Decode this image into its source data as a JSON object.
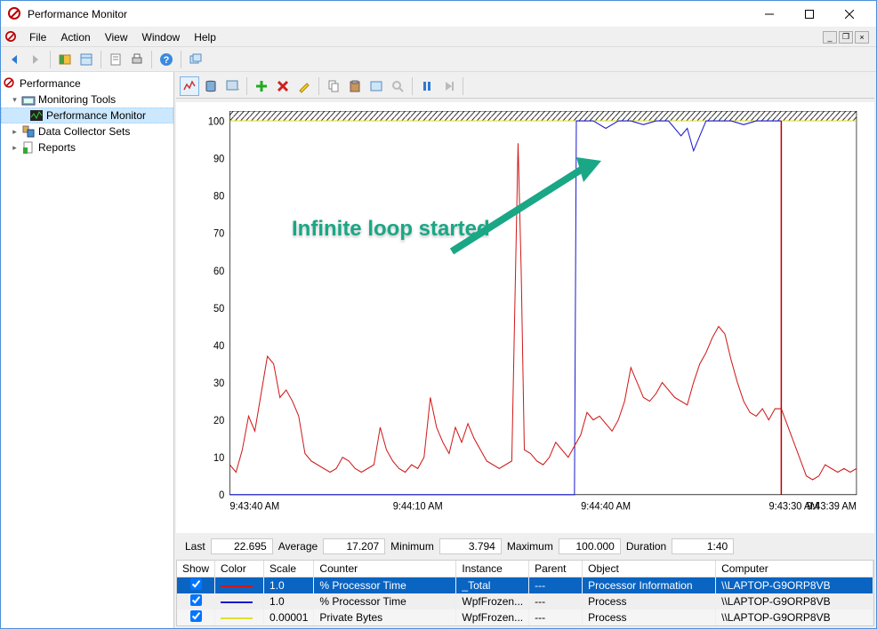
{
  "window": {
    "title": "Performance Monitor"
  },
  "menu": {
    "file": "File",
    "action": "Action",
    "view": "View",
    "window": "Window",
    "help": "Help"
  },
  "tree": {
    "root": "Performance",
    "monitoring": "Monitoring Tools",
    "perfmon": "Performance Monitor",
    "dcs": "Data Collector Sets",
    "reports": "Reports"
  },
  "annotation": "Infinite loop started",
  "stats": {
    "last_label": "Last",
    "last": "22.695",
    "avg_label": "Average",
    "avg": "17.207",
    "min_label": "Minimum",
    "min": "3.794",
    "max_label": "Maximum",
    "max": "100.000",
    "dur_label": "Duration",
    "dur": "1:40"
  },
  "xticks": {
    "t0": "9:43:40 AM",
    "t1": "9:44:10 AM",
    "t2": "9:44:40 AM",
    "t3": "9:43:30 AM",
    "t4": "9:43:39 AM"
  },
  "columns": {
    "show": "Show",
    "color": "Color",
    "scale": "Scale",
    "counter": "Counter",
    "instance": "Instance",
    "parent": "Parent",
    "object": "Object",
    "computer": "Computer"
  },
  "rows": [
    {
      "scale": "1.0",
      "counter": "% Processor Time",
      "instance": "_Total",
      "parent": "---",
      "object": "Processor Information",
      "computer": "\\\\LAPTOP-G9ORP8VB",
      "color": "#d01818"
    },
    {
      "scale": "1.0",
      "counter": "% Processor Time",
      "instance": "WpfFrozen...",
      "parent": "---",
      "object": "Process",
      "computer": "\\\\LAPTOP-G9ORP8VB",
      "color": "#1818d0"
    },
    {
      "scale": "0.00001",
      "counter": "Private Bytes",
      "instance": "WpfFrozen...",
      "parent": "---",
      "object": "Process",
      "computer": "\\\\LAPTOP-G9ORP8VB",
      "color": "#e0e030"
    }
  ],
  "chart_data": {
    "type": "line",
    "ylim": [
      0,
      100
    ],
    "yticks": [
      0,
      10,
      20,
      30,
      40,
      50,
      60,
      70,
      80,
      90,
      100
    ],
    "x_range_seconds": [
      0,
      100
    ],
    "x_tick_labels": [
      "9:43:40 AM",
      "9:44:10 AM",
      "9:44:40 AM",
      "9:43:30 AM",
      "9:43:39 AM"
    ],
    "time_bar_x": 88,
    "series": [
      {
        "name": "% Processor Time — Processor Information — _Total",
        "color": "#d01818",
        "points": [
          [
            0,
            8
          ],
          [
            1,
            6
          ],
          [
            2,
            12
          ],
          [
            3,
            21
          ],
          [
            4,
            17
          ],
          [
            6,
            37
          ],
          [
            7,
            35
          ],
          [
            8,
            26
          ],
          [
            9,
            28
          ],
          [
            10,
            25
          ],
          [
            11,
            21
          ],
          [
            12,
            11
          ],
          [
            13,
            9
          ],
          [
            14,
            8
          ],
          [
            15,
            7
          ],
          [
            16,
            6
          ],
          [
            17,
            7
          ],
          [
            18,
            10
          ],
          [
            19,
            9
          ],
          [
            20,
            7
          ],
          [
            21,
            6
          ],
          [
            22,
            7
          ],
          [
            23,
            8
          ],
          [
            24,
            18
          ],
          [
            25,
            12
          ],
          [
            26,
            9
          ],
          [
            27,
            7
          ],
          [
            28,
            6
          ],
          [
            29,
            8
          ],
          [
            30,
            7
          ],
          [
            31,
            10
          ],
          [
            32,
            26
          ],
          [
            33,
            18
          ],
          [
            34,
            14
          ],
          [
            35,
            11
          ],
          [
            36,
            18
          ],
          [
            37,
            14
          ],
          [
            38,
            19
          ],
          [
            39,
            15
          ],
          [
            40,
            12
          ],
          [
            41,
            9
          ],
          [
            42,
            8
          ],
          [
            43,
            7
          ],
          [
            44,
            8
          ],
          [
            45,
            9
          ],
          [
            46,
            94
          ],
          [
            46.5,
            60
          ],
          [
            47,
            12
          ],
          [
            48,
            11
          ],
          [
            49,
            9
          ],
          [
            50,
            8
          ],
          [
            51,
            10
          ],
          [
            52,
            14
          ],
          [
            53,
            12
          ],
          [
            54,
            10
          ],
          [
            55,
            13
          ],
          [
            56,
            16
          ],
          [
            57,
            22
          ],
          [
            58,
            20
          ],
          [
            59,
            21
          ],
          [
            60,
            19
          ],
          [
            61,
            17
          ],
          [
            62,
            20
          ],
          [
            63,
            25
          ],
          [
            64,
            34
          ],
          [
            65,
            30
          ],
          [
            66,
            26
          ],
          [
            67,
            25
          ],
          [
            68,
            27
          ],
          [
            69,
            30
          ],
          [
            70,
            28
          ],
          [
            71,
            26
          ],
          [
            72,
            25
          ],
          [
            73,
            24
          ],
          [
            74,
            30
          ],
          [
            75,
            35
          ],
          [
            76,
            38
          ],
          [
            77,
            42
          ],
          [
            78,
            45
          ],
          [
            79,
            43
          ],
          [
            80,
            36
          ],
          [
            81,
            30
          ],
          [
            82,
            25
          ],
          [
            83,
            22
          ],
          [
            84,
            21
          ],
          [
            85,
            23
          ],
          [
            86,
            20
          ],
          [
            87,
            23
          ],
          [
            88,
            23
          ],
          [
            92,
            5
          ],
          [
            93,
            4
          ],
          [
            94,
            5
          ],
          [
            95,
            8
          ],
          [
            96,
            7
          ],
          [
            97,
            6
          ],
          [
            98,
            7
          ],
          [
            99,
            6
          ],
          [
            100,
            7
          ]
        ]
      },
      {
        "name": "% Processor Time — Process — WpfFrozen",
        "color": "#1818d0",
        "points": [
          [
            0,
            0
          ],
          [
            54,
            0
          ],
          [
            55,
            0
          ],
          [
            55.3,
            100
          ],
          [
            56,
            100
          ],
          [
            58,
            100
          ],
          [
            60,
            98
          ],
          [
            62,
            100
          ],
          [
            64,
            100
          ],
          [
            66,
            99
          ],
          [
            68,
            100
          ],
          [
            70,
            100
          ],
          [
            72,
            96
          ],
          [
            73,
            98
          ],
          [
            74,
            92
          ],
          [
            75,
            96
          ],
          [
            76,
            100
          ],
          [
            78,
            100
          ],
          [
            80,
            100
          ],
          [
            82,
            99
          ],
          [
            84,
            100
          ],
          [
            86,
            100
          ],
          [
            88,
            100
          ]
        ]
      },
      {
        "name": "Private Bytes — Process — WpfFrozen",
        "color": "#e0e030",
        "points": [
          [
            0,
            100
          ],
          [
            100,
            100
          ]
        ]
      }
    ]
  }
}
